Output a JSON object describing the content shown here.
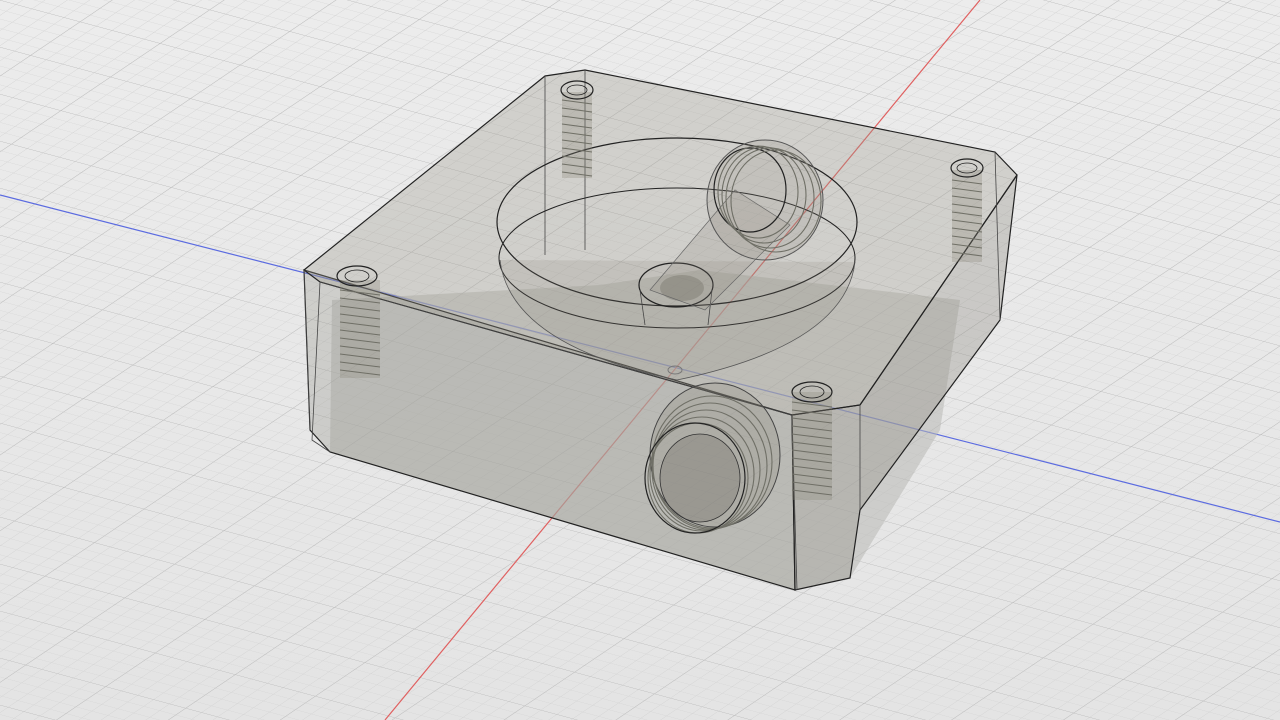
{
  "viewport": {
    "background": "#e8e8e8",
    "grid_minor_color": "#d2d2d2",
    "grid_major_color": "#bdbdbd",
    "x_axis_color": "#e06060",
    "y_axis_color": "#5b6be0"
  },
  "model": {
    "body_color": "#8a877c",
    "body_opacity": 0.35,
    "edge_color": "#222222",
    "thread_color": "#6f6f66",
    "features": [
      "threaded-post",
      "threaded-post",
      "threaded-post",
      "threaded-post",
      "circular-pocket",
      "center-hole",
      "side-threaded-port",
      "rear-threaded-port"
    ]
  }
}
